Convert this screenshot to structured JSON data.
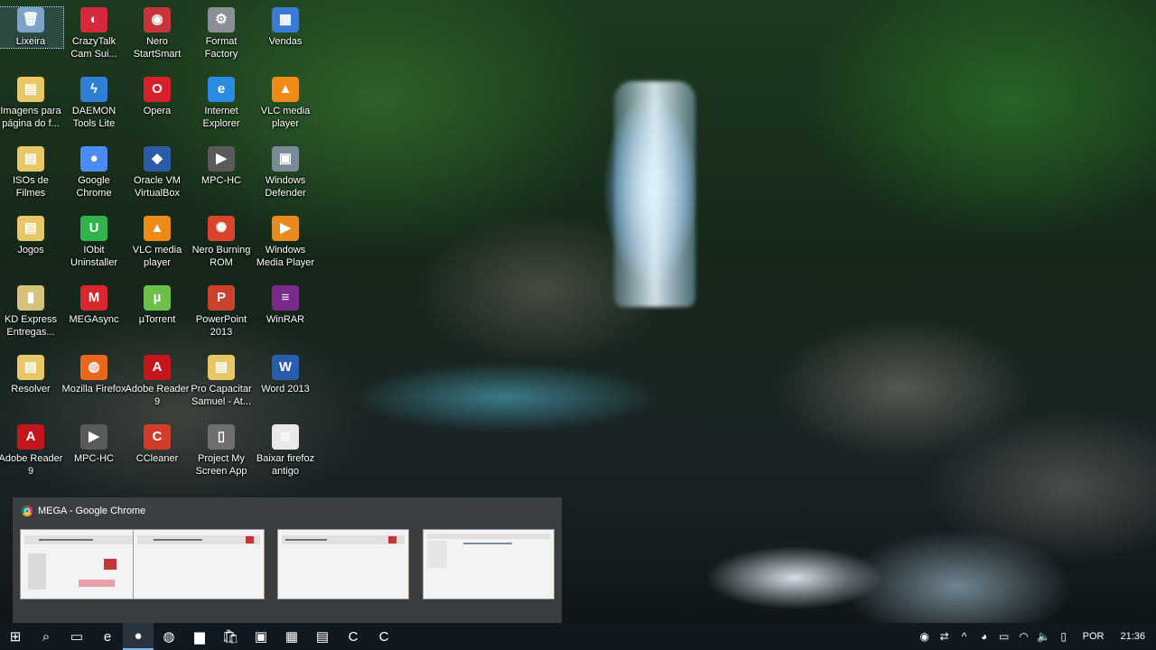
{
  "desktop_icons": [
    {
      "label": "Lixeira",
      "icon": "recycle-bin-icon",
      "glyph": "🗑",
      "color": "#7aa4c8"
    },
    {
      "label": "CrazyTalk Cam Sui...",
      "icon": "crazytalk-icon",
      "glyph": "◐",
      "color": "#d42a3c"
    },
    {
      "label": "Nero StartSmart",
      "icon": "nero-icon",
      "glyph": "◉",
      "color": "#c8343c"
    },
    {
      "label": "Format Factory",
      "icon": "format-factory-icon",
      "glyph": "⚙",
      "color": "#8a8f95"
    },
    {
      "label": "Vendas",
      "icon": "vendas-icon",
      "glyph": "▦",
      "color": "#3a7bd5"
    },
    {
      "label": "Imagens para página do f...",
      "icon": "folder-icon",
      "glyph": "▤",
      "color": "#e8c766"
    },
    {
      "label": "DAEMON Tools Lite",
      "icon": "daemon-tools-icon",
      "glyph": "ϟ",
      "color": "#2f7fd6"
    },
    {
      "label": "Opera",
      "icon": "opera-icon",
      "glyph": "O",
      "color": "#d8202a"
    },
    {
      "label": "Internet Explorer",
      "icon": "internet-explorer-icon",
      "glyph": "e",
      "color": "#2a8be0"
    },
    {
      "label": "VLC media player",
      "icon": "vlc-icon",
      "glyph": "▲",
      "color": "#f08a16"
    },
    {
      "label": "ISOs de Filmes",
      "icon": "folder-icon",
      "glyph": "▤",
      "color": "#e8c766"
    },
    {
      "label": "Google Chrome",
      "icon": "chrome-icon",
      "glyph": "●",
      "color": "#4b8bf4"
    },
    {
      "label": "Oracle VM VirtualBox",
      "icon": "virtualbox-icon",
      "glyph": "◆",
      "color": "#2a5aa8"
    },
    {
      "label": "MPC-HC",
      "icon": "mpc-hc-icon",
      "glyph": "▶",
      "color": "#5a5a5a"
    },
    {
      "label": "Windows Defender",
      "icon": "windows-defender-icon",
      "glyph": "▣",
      "color": "#7b8a99"
    },
    {
      "label": "Jogos",
      "icon": "folder-icon",
      "glyph": "▤",
      "color": "#e8c766"
    },
    {
      "label": "IObit Uninstaller",
      "icon": "iobit-icon",
      "glyph": "U",
      "color": "#2fb34a"
    },
    {
      "label": "VLC media player",
      "icon": "vlc-icon",
      "glyph": "▲",
      "color": "#f08a16"
    },
    {
      "label": "Nero Burning ROM",
      "icon": "nero-burning-icon",
      "glyph": "✺",
      "color": "#d8452a"
    },
    {
      "label": "Windows Media Player",
      "icon": "media-player-icon",
      "glyph": "▶",
      "color": "#e88a1e"
    },
    {
      "label": "KD Express Entregas...",
      "icon": "kd-express-icon",
      "glyph": "▮",
      "color": "#d7c27a"
    },
    {
      "label": "MEGAsync",
      "icon": "megasync-icon",
      "glyph": "M",
      "color": "#d9272e"
    },
    {
      "label": "µTorrent",
      "icon": "utorrent-icon",
      "glyph": "µ",
      "color": "#6cc04a"
    },
    {
      "label": "PowerPoint 2013",
      "icon": "powerpoint-icon",
      "glyph": "P",
      "color": "#c9432a"
    },
    {
      "label": "WinRAR",
      "icon": "winrar-icon",
      "glyph": "≡",
      "color": "#7a2a8a"
    },
    {
      "label": "Resolver",
      "icon": "folder-icon",
      "glyph": "▤",
      "color": "#e8c766"
    },
    {
      "label": "Mozilla Firefox",
      "icon": "firefox-icon",
      "glyph": "◍",
      "color": "#e8671e"
    },
    {
      "label": "Adobe Reader 9",
      "icon": "adobe-reader-icon",
      "glyph": "A",
      "color": "#c4161c"
    },
    {
      "label": "Pro Capacitar Samuel - At...",
      "icon": "folder-icon",
      "glyph": "▤",
      "color": "#e8c766"
    },
    {
      "label": "Word 2013",
      "icon": "word-icon",
      "glyph": "W",
      "color": "#2a5cae"
    },
    {
      "label": "Adobe Reader 9",
      "icon": "adobe-reader-icon",
      "glyph": "A",
      "color": "#c4161c"
    },
    {
      "label": "MPC-HC",
      "icon": "mpc-hc-icon",
      "glyph": "▶",
      "color": "#5a5a5a"
    },
    {
      "label": "CCleaner",
      "icon": "ccleaner-icon",
      "glyph": "C",
      "color": "#d23c2a"
    },
    {
      "label": "Project My Screen App",
      "icon": "project-screen-icon",
      "glyph": "▯",
      "color": "#6f6f6f"
    },
    {
      "label": "Baixar firefoz antigo",
      "icon": "text-file-icon",
      "glyph": "≣",
      "color": "#e9e9e9"
    }
  ],
  "preview": {
    "title": "MEGA - Google Chrome",
    "icon": "chrome-icon",
    "thumbnails": 4
  },
  "taskbar": {
    "pinned": [
      {
        "icon": "windows-start-icon",
        "glyph": "⊞"
      },
      {
        "icon": "search-icon",
        "glyph": "⌕"
      },
      {
        "icon": "task-view-icon",
        "glyph": "▭"
      },
      {
        "icon": "edge-icon",
        "glyph": "e"
      },
      {
        "icon": "chrome-icon",
        "glyph": "●"
      },
      {
        "icon": "firefox-icon",
        "glyph": "◍"
      },
      {
        "icon": "file-explorer-icon",
        "glyph": "▆"
      },
      {
        "icon": "store-icon",
        "glyph": "🛍"
      },
      {
        "icon": "winrar-taskbar-icon",
        "glyph": "▣"
      },
      {
        "icon": "calculator-icon",
        "glyph": "▦"
      },
      {
        "icon": "notepad-icon",
        "glyph": "▤"
      },
      {
        "icon": "camtasia-icon",
        "glyph": "C"
      },
      {
        "icon": "camtasia-recorder-icon",
        "glyph": "C"
      }
    ],
    "active_index": 4,
    "tray": [
      {
        "icon": "connection-icon",
        "glyph": "◉"
      },
      {
        "icon": "network-share-icon",
        "glyph": "⇄"
      },
      {
        "icon": "show-hidden-icons-icon",
        "glyph": "^"
      },
      {
        "icon": "antivirus-icon",
        "glyph": "◕"
      },
      {
        "icon": "battery-icon",
        "glyph": "▭"
      },
      {
        "icon": "wifi-icon",
        "glyph": "◠"
      },
      {
        "icon": "volume-icon",
        "glyph": "🔈"
      },
      {
        "icon": "action-center-icon",
        "glyph": "▯"
      }
    ],
    "language": "POR",
    "clock": "21:36"
  }
}
